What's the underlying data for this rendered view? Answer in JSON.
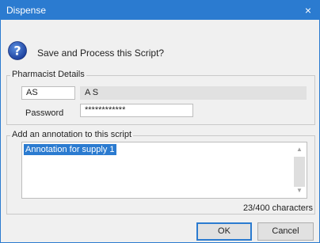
{
  "window": {
    "title": "Dispense",
    "close_glyph": "×"
  },
  "prompt": {
    "icon": "question-icon",
    "text": "Save and Process this Script?"
  },
  "pharmacist": {
    "group_label": "Pharmacist Details",
    "initials": "AS",
    "name": "A S",
    "password_label": "Password",
    "password_value": "************"
  },
  "annotation": {
    "group_label": "Add an annotation to this script",
    "text": "Annotation for supply 1",
    "char_count": "23/400 characters"
  },
  "buttons": {
    "ok": "OK",
    "cancel": "Cancel"
  },
  "colors": {
    "accent": "#2b7bd0",
    "dialog_bg": "#f0f0f0"
  }
}
